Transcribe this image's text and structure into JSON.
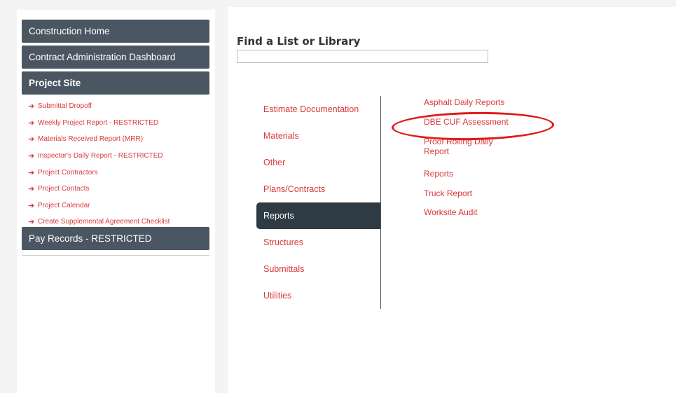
{
  "sidebar": {
    "nav": [
      {
        "label": "Construction Home"
      },
      {
        "label": "Contract Administration Dashboard"
      },
      {
        "label": "Project Site"
      },
      {
        "label": "Pay Records - RESTRICTED"
      }
    ],
    "project_site_items": [
      {
        "label": "Submittal Dropoff"
      },
      {
        "label": "Weekly Project Report - RESTRICTED"
      },
      {
        "label": "Materials Received Report (MRR)"
      },
      {
        "label": "Inspector's Daily Report - RESTRICTED"
      },
      {
        "label": "Project Contractors"
      },
      {
        "label": "Project Contacts"
      },
      {
        "label": "Project Calendar"
      },
      {
        "label": "Create Supplemental Agreement Checklist"
      }
    ],
    "arrow_icon": "arrow-right-icon"
  },
  "main": {
    "title": "Find a List or Library",
    "search": {
      "value": "",
      "placeholder": ""
    },
    "categories": [
      {
        "label": "Estimate Documentation"
      },
      {
        "label": "Materials"
      },
      {
        "label": "Other"
      },
      {
        "label": "Plans/Contracts"
      },
      {
        "label": "Reports"
      },
      {
        "label": "Structures"
      },
      {
        "label": "Submittals"
      },
      {
        "label": "Utilities"
      }
    ],
    "selected_category": "Reports",
    "lists": [
      {
        "label": "Asphalt Daily Reports"
      },
      {
        "label": "DBE CUF Assessment"
      },
      {
        "label": "Proof Rolling Daily Report"
      },
      {
        "label": "Reports"
      },
      {
        "label": "Truck Report"
      },
      {
        "label": "Worksite Audit"
      }
    ]
  },
  "colors": {
    "nav_bg": "#4a5661",
    "selected_bg": "#2f3b44",
    "link": "#d9383a",
    "annotation": "#e01a1a"
  }
}
